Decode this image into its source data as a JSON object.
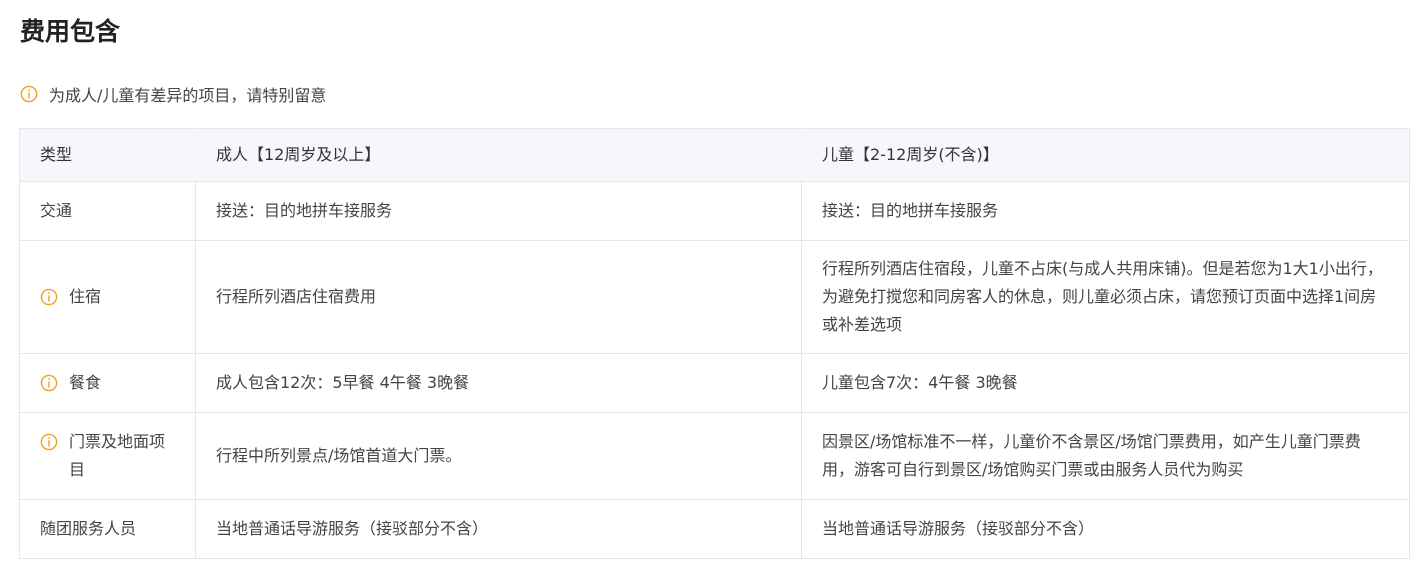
{
  "section": {
    "title": "费用包含",
    "notice": "为成人/儿童有差异的项目，请特别留意"
  },
  "colors": {
    "accent": "#f0a020",
    "header_bg": "#f5f7fa",
    "border": "#e6e6e6"
  },
  "table": {
    "headers": {
      "type": "类型",
      "adult": "成人【12周岁及以上】",
      "child": "儿童【2-12周岁(不含)】"
    },
    "rows": [
      {
        "type": "交通",
        "adult": "接送：目的地拼车接服务",
        "child": "接送：目的地拼车接服务"
      },
      {
        "type": "住宿",
        "adult": "行程所列酒店住宿费用",
        "child": "行程所列酒店住宿段，儿童不占床(与成人共用床铺)。但是若您为1大1小出行，为避免打搅您和同房客人的休息，则儿童必须占床，请您预订页面中选择1间房或补差选项"
      },
      {
        "type": "餐食",
        "adult": "成人包含12次：5早餐 4午餐 3晚餐",
        "child": "儿童包含7次：4午餐 3晚餐"
      },
      {
        "type": "门票及地面项目",
        "adult": "行程中所列景点/场馆首道大门票。",
        "child": "因景区/场馆标准不一样，儿童价不含景区/场馆门票费用，如产生儿童门票费用，游客可自行到景区/场馆购买门票或由服务人员代为购买"
      },
      {
        "type": "随团服务人员",
        "adult": "当地普通话导游服务（接驳部分不含）",
        "child": "当地普通话导游服务（接驳部分不含）"
      }
    ]
  }
}
